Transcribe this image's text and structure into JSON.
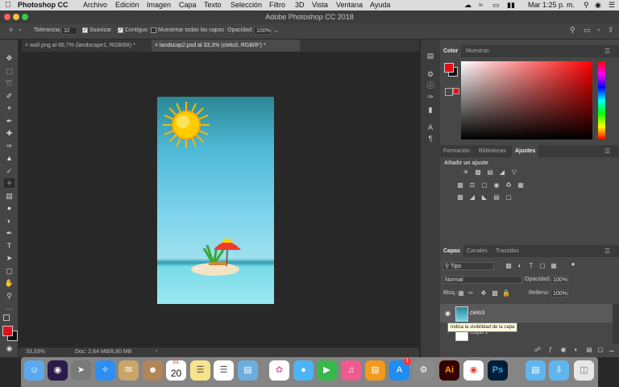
{
  "menubar": {
    "apple": "",
    "app": "Photoshop CC",
    "items": [
      "Archivo",
      "Edición",
      "Imagen",
      "Capa",
      "Texto",
      "Selección",
      "Filtro",
      "3D",
      "Vista",
      "Ventana",
      "Ayuda"
    ],
    "clock": "Mar 1:25 p. m."
  },
  "window": {
    "title": "Adobe Photoshop CC 2018"
  },
  "options": {
    "tolerance_label": "Tolerancia:",
    "tolerance_value": "32",
    "antialias_label": "Suavizar",
    "antialias_checked": true,
    "contiguous_label": "Contiguo",
    "contiguous_checked": true,
    "sample_all_label": "Muestrear todas las capas",
    "sample_all_checked": false,
    "opacity_label": "Opacidad:",
    "opacity_value": "100%"
  },
  "tabs": [
    {
      "label": "wall.png al 66,7% (landscape1, RGB/8#) *",
      "active": false
    },
    {
      "label": "landscap2.psd al 33,3% (cielo3, RGB/8*) *",
      "active": true
    }
  ],
  "status": {
    "zoom": "33,33%",
    "doc": "Doc: 2,64 MB/8,80 MB"
  },
  "color_panel": {
    "tabs": [
      "Color",
      "Muestras"
    ],
    "fg": "#e0101a",
    "bg": "#111111"
  },
  "adjust_panel": {
    "tabs": [
      "Formación",
      "Bibliotecas",
      "Ajustes"
    ],
    "heading": "Añadir un ajuste"
  },
  "layers_panel": {
    "tabs": [
      "Capas",
      "Canales",
      "Trazados"
    ],
    "filter": "Tipo",
    "blend_mode": "Normal",
    "opacity_label": "Opacidad:",
    "opacity_value": "100%",
    "lock_label": "Bloq.:",
    "fill_label": "Relleno:",
    "fill_value": "100%",
    "layers": [
      {
        "name": "cielo3",
        "visible": true,
        "selected": true
      },
      {
        "name": "Capa 1",
        "visible": false,
        "selected": false
      }
    ],
    "tooltip": "Indica la visibilidad de la capa"
  },
  "dock": {
    "calendar_month": "JUL",
    "calendar_day": "20",
    "notification_badge": "1",
    "apps": [
      "finder-icon",
      "siri-icon",
      "launchpad-icon",
      "safari-icon",
      "mail-stamp-icon",
      "contacts-icon",
      "calendar-icon",
      "notes-icon",
      "reminders-icon",
      "preview-icon",
      "photos-icon",
      "messages-icon",
      "facetime-icon",
      "itunes-icon",
      "ibooks-icon",
      "appstore-icon",
      "system-prefs-icon",
      "illustrator-icon",
      "chrome-icon",
      "photoshop-icon",
      "folder-icon",
      "downloads-icon",
      "trash-icon"
    ],
    "illustrator_label": "Ai",
    "photoshop_label": "Ps"
  }
}
